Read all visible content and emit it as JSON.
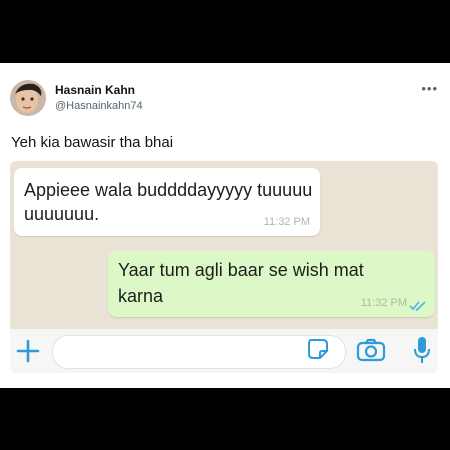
{
  "tweet": {
    "author_name": "Hasnain Kahn",
    "author_handle": "@Hasnainkahn74",
    "text": "Yeh kia bawasir tha bhai"
  },
  "chat": {
    "messages": [
      {
        "direction": "incoming",
        "text": "Appieee wala buddddayyyyy tuuuuu uuuuuuu.",
        "time": "11:32 PM"
      },
      {
        "direction": "outgoing",
        "text": "Yaar tum agli baar se wish mat karna",
        "time": "11:32 PM",
        "status": "read"
      }
    ],
    "input_placeholder": ""
  },
  "colors": {
    "accent": "#2f9bd6",
    "outgoing_bubble": "#dcf8c6",
    "incoming_bubble": "#ffffff",
    "read_ticks": "#4fb3e8"
  },
  "icons": [
    "more-icon",
    "plus-icon",
    "sticker-icon",
    "camera-icon",
    "mic-icon",
    "double-check-icon"
  ]
}
